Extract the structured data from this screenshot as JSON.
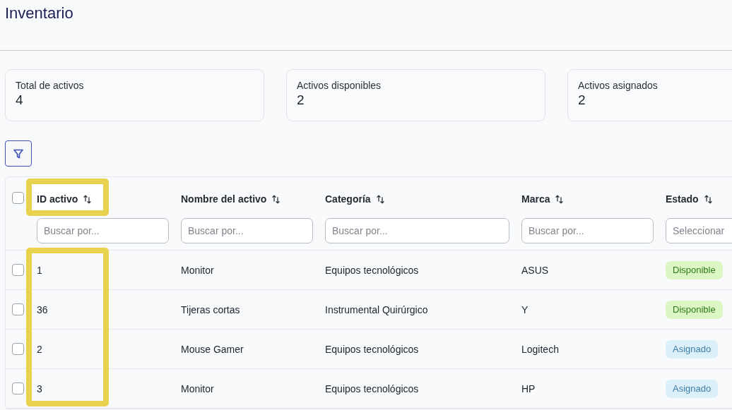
{
  "page": {
    "title": "Inventario"
  },
  "stats": [
    {
      "label": "Total de activos",
      "value": "4"
    },
    {
      "label": "Activos disponibles",
      "value": "2"
    },
    {
      "label": "Activos asignados",
      "value": "2"
    }
  ],
  "table": {
    "select_all": {
      "checked": false
    },
    "columns": [
      {
        "label": "ID activo",
        "placeholder": "Buscar por...",
        "highlighted": true
      },
      {
        "label": "Nombre del activo",
        "placeholder": "Buscar por...",
        "highlighted": false
      },
      {
        "label": "Categoría",
        "placeholder": "Buscar por...",
        "highlighted": false
      },
      {
        "label": "Marca",
        "placeholder": "Buscar por...",
        "highlighted": false
      },
      {
        "label": "Estado",
        "placeholder": "Seleccionar",
        "highlighted": false
      }
    ],
    "rows": [
      {
        "checked": false,
        "cells": [
          "1",
          "Monitor",
          "Equipos tecnológicos",
          "ASUS"
        ],
        "status": {
          "label": "Disponible",
          "kind": "available"
        }
      },
      {
        "checked": false,
        "cells": [
          "36",
          "Tijeras cortas",
          "Instrumental Quirúrgico",
          "Y"
        ],
        "status": {
          "label": "Disponible",
          "kind": "available"
        }
      },
      {
        "checked": false,
        "cells": [
          "2",
          "Mouse Gamer",
          "Equipos tecnológicos",
          "Logitech"
        ],
        "status": {
          "label": "Asignado",
          "kind": "assigned"
        }
      },
      {
        "checked": false,
        "cells": [
          "3",
          "Monitor",
          "Equipos tecnológicos",
          "HP"
        ],
        "status": {
          "label": "Asignado",
          "kind": "assigned"
        }
      }
    ]
  }
}
